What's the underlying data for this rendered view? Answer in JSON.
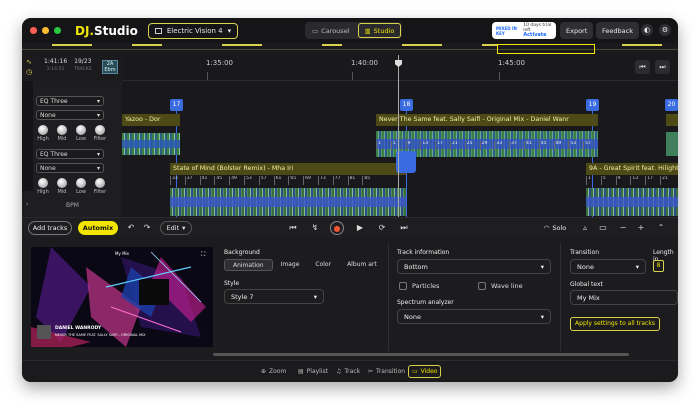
{
  "app": {
    "logo_prefix": "DJ.",
    "logo_suffix": "Studio",
    "project_name": "Electric Vision 4",
    "modes": [
      {
        "label": "Carousel"
      },
      {
        "label": "Studio"
      }
    ],
    "trial": {
      "brand": "MIXED IN KEY",
      "text": "10 days trial left",
      "action": "Activate"
    },
    "export_label": "Export",
    "feedback_label": "Feedback"
  },
  "ruler": {
    "time": "1:41:16",
    "time_sub": "2:14:55",
    "tracks": "19/23",
    "tracks_sub": "TRACKS",
    "key": "2A",
    "key_sub": "Ebm",
    "labels": [
      "1:35:00",
      "1:40:00",
      "1:45:00"
    ]
  },
  "decks": [
    {
      "eq": "EQ Three",
      "fx": "None",
      "knobs": [
        "High",
        "Mid",
        "Low",
        "Filter"
      ]
    },
    {
      "eq": "EQ Three",
      "fx": "None",
      "knobs": [
        "High",
        "Mid",
        "Low",
        "Filter"
      ]
    }
  ],
  "bpm_label": "BPM",
  "bpm_ticks": [
    "128",
    "130",
    "133",
    "133",
    "135",
    "133"
  ],
  "cues": [
    "17",
    "18",
    "19",
    "20"
  ],
  "clips": {
    "top_left": "Yazoo - Dor",
    "top_mid": "Never The Same feat. Sally Saifi - Original Mix - Daniel Wanr",
    "mid_left": "State of Mind (Bolster Remix) - Mha Iri",
    "mid_right": "9A - Great Spirit feat. Hilight Tribe"
  },
  "beats": {
    "row1": [
      "65",
      "",
      "",
      "",
      "",
      "",
      "",
      "",
      "",
      "",
      "",
      "",
      "",
      "",
      "",
      "",
      "",
      "",
      "",
      "",
      "",
      "",
      "",
      "",
      "",
      "",
      "",
      "",
      "",
      "",
      ""
    ],
    "row2": [
      "1",
      "5",
      "9",
      "13",
      "17",
      "21",
      "25",
      "29",
      "33",
      "37",
      "41",
      "45",
      "49",
      "53",
      "57",
      "61",
      "65",
      "69"
    ],
    "row3": [
      "33",
      "37",
      "41",
      "45",
      "49",
      "53",
      "57",
      "61",
      "65",
      "69",
      "73",
      "77",
      "81",
      "85"
    ],
    "row4": [
      "9",
      "13",
      "17",
      "21",
      "25",
      "29",
      "33",
      "37",
      "41",
      "45",
      "49",
      "53",
      "57",
      "61"
    ],
    "row5": [
      "1",
      "5",
      "9",
      "13",
      "17",
      "21"
    ]
  },
  "transport": {
    "add_tracks": "Add tracks",
    "automix": "Automix",
    "edit": "Edit",
    "solo": "Solo"
  },
  "video": {
    "preview": {
      "mix_label": "My Mix",
      "artist": "DANIEL WANRODY",
      "track": "NEVER THE SAME FEAT. SALLY SAIFI - ORIGINAL MIX"
    },
    "background_label": "Background",
    "bg_tabs": [
      "Animation",
      "Image",
      "Color",
      "Album art"
    ],
    "style_label": "Style",
    "style_value": "Style 7",
    "track_info_label": "Track information",
    "track_info_value": "Bottom",
    "particles_label": "Particles",
    "waveline_label": "Wave line",
    "spectrum_label": "Spectrum analyzer",
    "spectrum_value": "None",
    "transition_label": "Transition",
    "transition_value": "None",
    "length_label": "Length in",
    "length_value": "8",
    "global_text_label": "Global text",
    "global_text_value": "My Mix",
    "apply_label": "Apply settings to all tracks"
  },
  "bottom_tabs": [
    "Zoom",
    "Playlist",
    "Track",
    "Transition",
    "Video"
  ],
  "colors": {
    "accent": "#f2e600",
    "cue": "#3a6be0",
    "clip": "#4d4a18"
  }
}
